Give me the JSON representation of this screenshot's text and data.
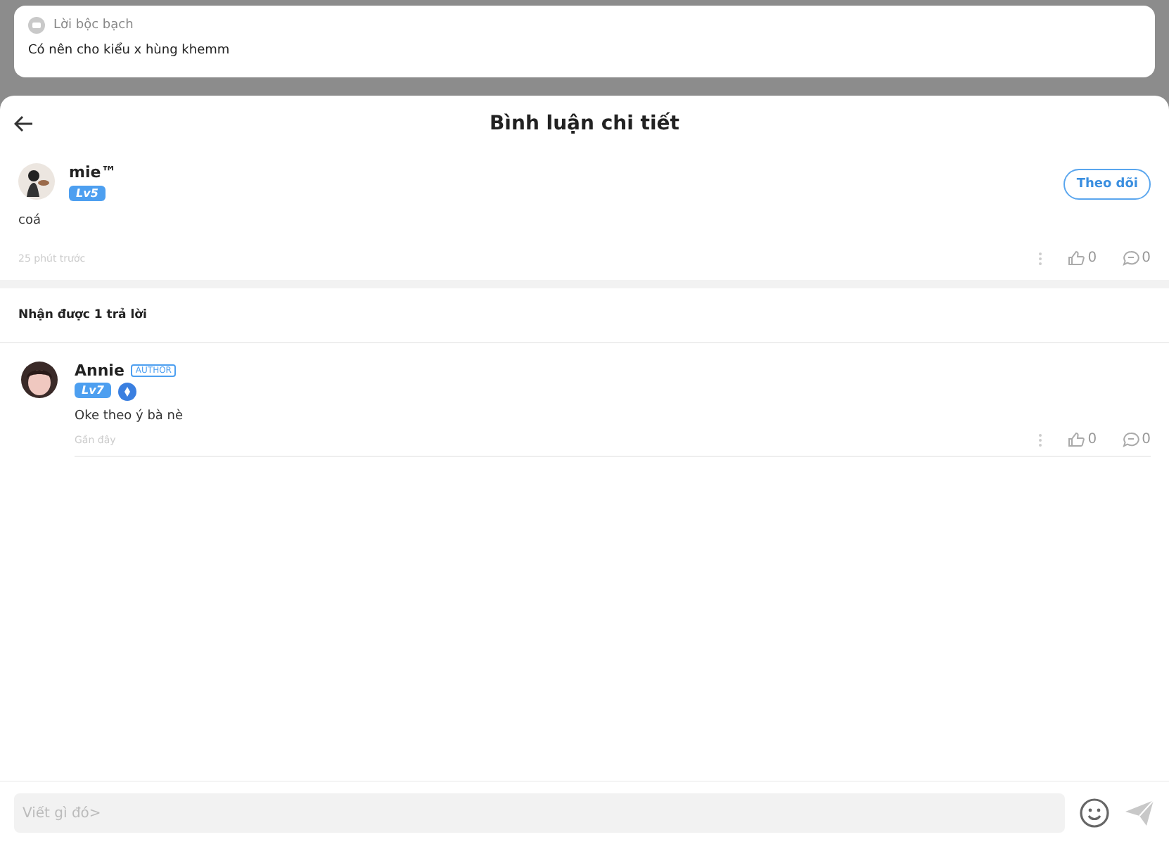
{
  "post": {
    "category": "Lời bộc bạch",
    "text": "Có nên cho kiểu x hùng khemm"
  },
  "sheet": {
    "title": "Bình luận chi tiết"
  },
  "comment": {
    "author": "mie™",
    "level": "Lv5",
    "follow": "Theo dõi",
    "text": "coá",
    "time": "25 phút trước",
    "likes": "0",
    "replies": "0"
  },
  "replies_heading": "Nhận được 1 trả lời",
  "replies": [
    {
      "author": "Annie",
      "author_tag": "AUTHOR",
      "level": "Lv7",
      "verified": true,
      "text": "Oke theo ý bà nè",
      "time": "Gần đây",
      "likes": "0",
      "replies": "0"
    }
  ],
  "composer": {
    "placeholder": "Viết gì đó>"
  }
}
